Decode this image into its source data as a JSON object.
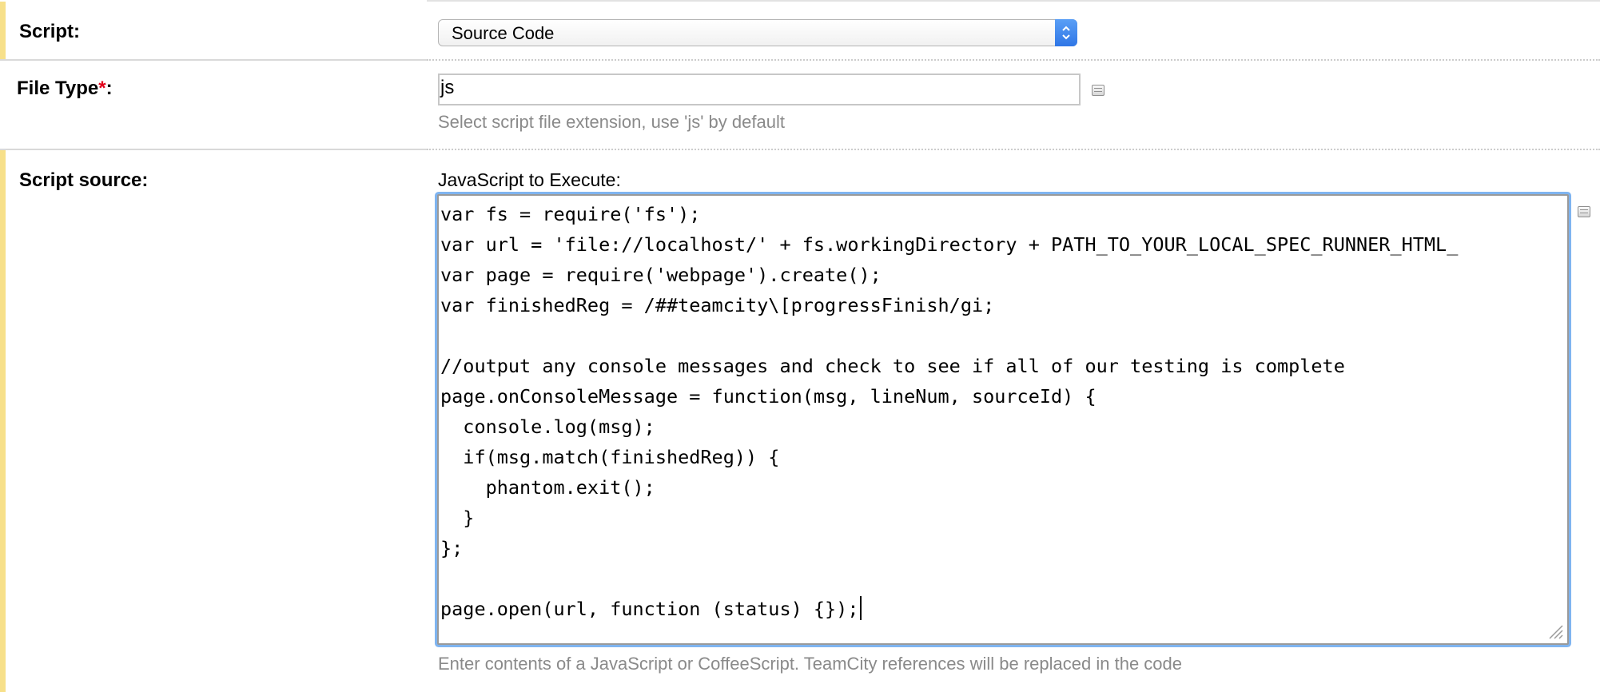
{
  "script_row": {
    "label": "Script:",
    "select_value": "Source Code"
  },
  "file_type_row": {
    "label": "File Type",
    "required_mark": "*",
    "label_suffix": ":",
    "input_value": "js",
    "hint": "Select script file extension, use 'js' by default"
  },
  "source_row": {
    "label": "Script source:",
    "caption": "JavaScript to Execute:",
    "code_lines": [
      "var fs = require('fs');",
      "var url = 'file://localhost/' + fs.workingDirectory + PATH_TO_YOUR_LOCAL_SPEC_RUNNER_HTML_",
      "var page = require('webpage').create();",
      "var finishedReg = /##teamcity\\[progressFinish/gi;",
      "",
      "//output any console messages and check to see if all of our testing is complete",
      "page.onConsoleMessage = function(msg, lineNum, sourceId) {",
      "  console.log(msg);",
      "  if(msg.match(finishedReg)) {",
      "    phantom.exit();",
      "  }",
      "};",
      "",
      "page.open(url, function (status) {});"
    ],
    "hint": "Enter contents of a JavaScript or CoffeeScript. TeamCity references will be replaced in the code"
  },
  "colors": {
    "row_accent": "#f7e08a",
    "required": "#e2001a",
    "focus_ring": "#7fb4f0",
    "select_arrow": "#2f76e6",
    "hint_text": "#8a8a8a"
  },
  "icons": [
    "chevron-up-down-icon",
    "field-menu-icon",
    "resize-grip-icon"
  ]
}
